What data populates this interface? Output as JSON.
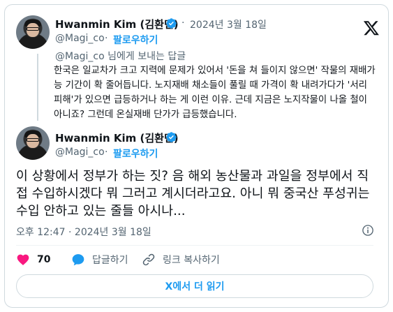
{
  "reply_tweet": {
    "author_name": "Hwanmin Kim (김환민)",
    "separator": "·",
    "date": "2024년 3월 18일",
    "handle": "@Magi_co",
    "handle_dot": "·",
    "follow_label": "팔로우하기",
    "replying_to_handle": "@Magi_co",
    "replying_to_suffix": " 님에게 보내는 답글",
    "body": "한국은 일교차가 크고 지력에 문제가 있어서 '돈을 쳐 들이지 않으면' 작물의 재배가능 기간이 확 줄어듭니다. 노지재배 채소들이 풀릴 때 가격이 확 내려가다가 '서리 피해'가 있으면 급등하거나 하는 게 이런 이유. 근데 지금은 노지작물이 나올 철이 아니죠? 그런데 온실재배 단가가 급등했습니다."
  },
  "main_tweet": {
    "author_name": "Hwanmin Kim (김환민)",
    "handle": "@Magi_co",
    "handle_dot": "·",
    "follow_label": "팔로우하기",
    "body": "이 상황에서 정부가 하는 짓? 음 해외 농산물과 과일을 정부에서 직접 수입하시겠다 뭐 그러고 계시더라고요. 아니 뭐 중국산 푸성귀는 수입 안하고 있는 줄들 아시나...",
    "timestamp": "오후 12:47 · 2024년 3월 18일"
  },
  "actions": {
    "like_count": "70",
    "reply_label": "답글하기",
    "copy_link_label": "링크 복사하기"
  },
  "read_more_label": "X에서 더 읽기",
  "icons": [
    "x-logo-icon",
    "verified-badge-icon",
    "heart-icon",
    "comment-icon",
    "link-icon",
    "info-icon"
  ],
  "colors": {
    "accent": "#1d9bf0",
    "like": "#f91880",
    "muted": "#536471",
    "border": "#cfd9de"
  }
}
